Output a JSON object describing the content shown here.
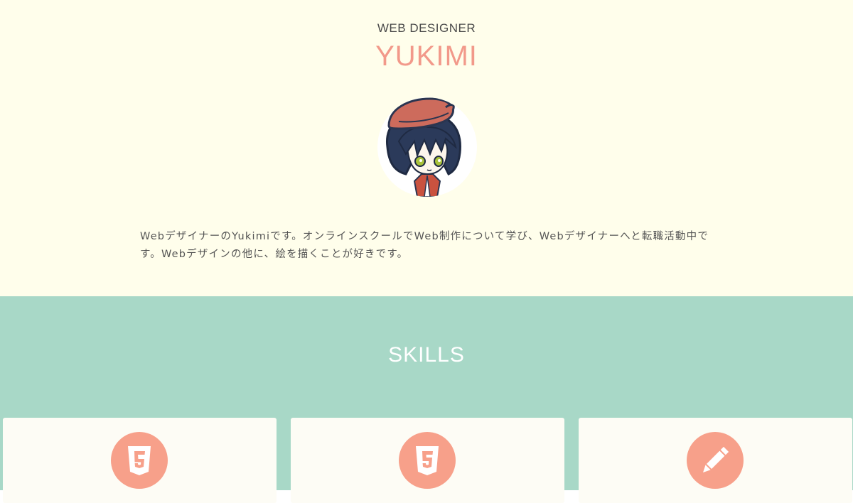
{
  "hero": {
    "role": "WEB DESIGNER",
    "name": "YUKIMI",
    "bio": "WebデザイナーのYukimiです。オンラインスクールでWeb制作について学び、Webデザイナーへと転職活動中です。Webデザインの他に、絵を描くことが好きです。"
  },
  "skills": {
    "title": "SKILLS",
    "cards": [
      {
        "icon": "html5-icon"
      },
      {
        "icon": "css3-icon"
      },
      {
        "icon": "pencil-icon"
      }
    ]
  },
  "colors": {
    "hero_bg": "#fffeeb",
    "accent": "#f2998a",
    "skills_bg": "#a8d8c7",
    "icon_circle": "#f7a08a"
  }
}
